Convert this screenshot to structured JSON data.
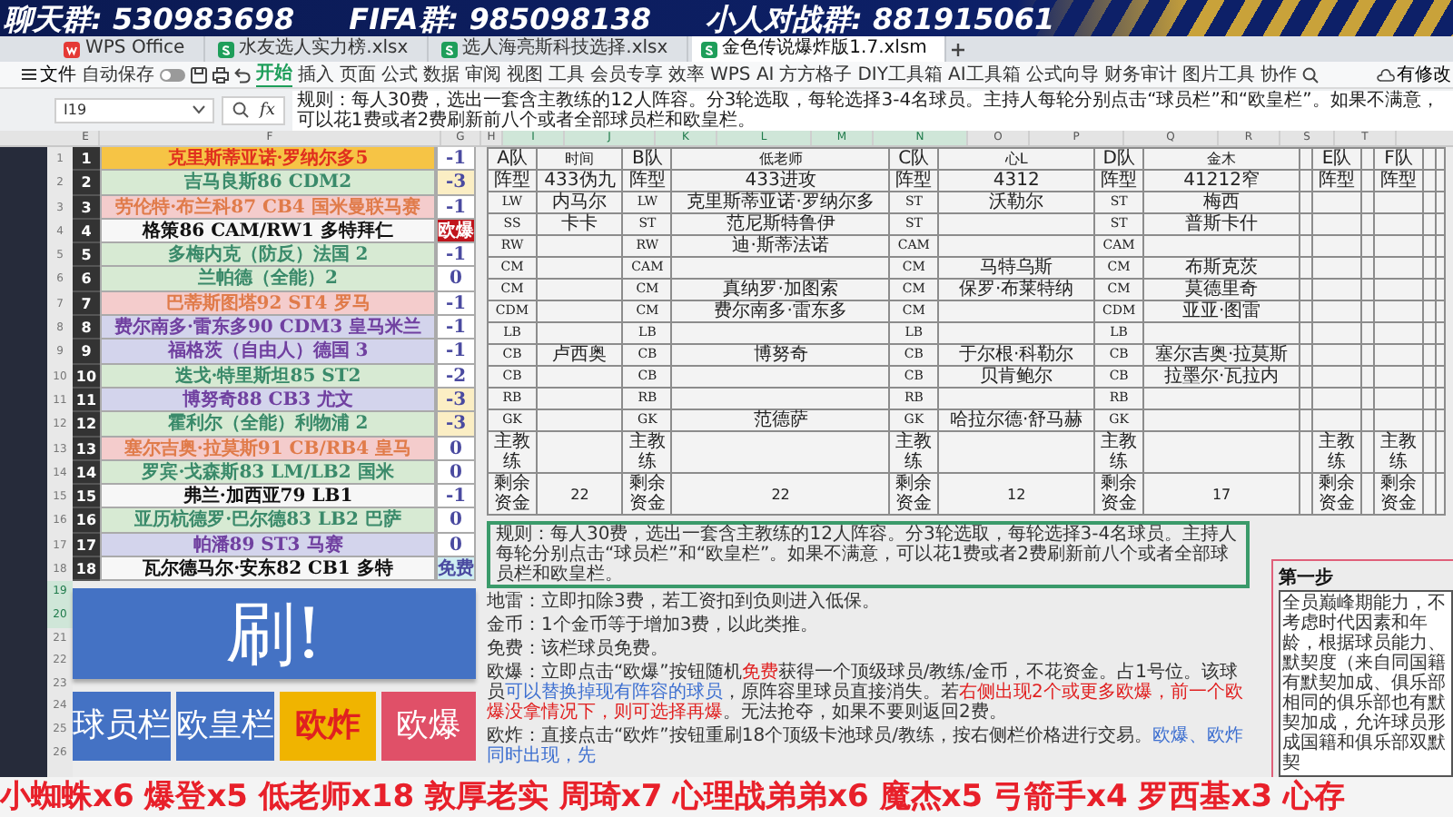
{
  "stream_banner": [
    "聊天群: 530983698",
    "FIFA群: 985098138",
    "小人对战群: 881915061"
  ],
  "tabs": [
    {
      "label": "WPS Office",
      "kind": "home",
      "selected": false
    },
    {
      "label": "水友选人实力榜.xlsx",
      "kind": "sheet",
      "selected": false
    },
    {
      "label": "选人海亮斯科技选择.xlsx",
      "kind": "sheet",
      "selected": false
    },
    {
      "label": "金色传说爆炸版1.7.xlsm",
      "kind": "sheet",
      "selected": true
    }
  ],
  "toolbar": {
    "file": "文件",
    "autosave": "自动保存",
    "autosave_on": false,
    "menu": [
      {
        "label": "开始",
        "selected": true
      },
      {
        "label": "插入",
        "selected": false
      },
      {
        "label": "页面",
        "selected": false
      },
      {
        "label": "公式",
        "selected": false
      },
      {
        "label": "数据",
        "selected": false
      },
      {
        "label": "审阅",
        "selected": false
      },
      {
        "label": "视图",
        "selected": false
      },
      {
        "label": "工具",
        "selected": false
      },
      {
        "label": "会员专享",
        "selected": false
      },
      {
        "label": "效率",
        "selected": false
      },
      {
        "label": "WPS AI",
        "selected": false
      },
      {
        "label": "方方格子",
        "selected": false
      },
      {
        "label": "DIY工具箱",
        "selected": false
      },
      {
        "label": "AI工具箱",
        "selected": false
      },
      {
        "label": "公式向导",
        "selected": false
      },
      {
        "label": "财务审计",
        "selected": false
      },
      {
        "label": "图片工具",
        "selected": false
      },
      {
        "label": "协作",
        "selected": false
      }
    ],
    "status": "有修改"
  },
  "formula_bar": {
    "cell": "I19",
    "fx": "fx",
    "content": "规则：每人30费，选出一套含主教练的12人阵容。分3轮选取，每轮选择3-4名球员。主持人每轮分别点击“球员栏”和“欧皇栏”。如果不满意，可以花1费或者2费刷新前八个或者全部球员栏和欧皇栏。"
  },
  "column_headers": [
    {
      "label": "E",
      "selected": false
    },
    {
      "label": "F",
      "selected": false
    },
    {
      "label": "G",
      "selected": false
    },
    {
      "label": "H",
      "selected": false
    },
    {
      "label": "I",
      "selected": true
    },
    {
      "label": "J",
      "selected": true
    },
    {
      "label": "K",
      "selected": true
    },
    {
      "label": "L",
      "selected": true
    },
    {
      "label": "M",
      "selected": true
    },
    {
      "label": "N",
      "selected": true
    },
    {
      "label": "O",
      "selected": false
    },
    {
      "label": "P",
      "selected": false
    },
    {
      "label": "Q",
      "selected": false
    },
    {
      "label": "R",
      "selected": false
    },
    {
      "label": "S",
      "selected": false
    },
    {
      "label": "T",
      "selected": false
    }
  ],
  "row_numbers": [
    {
      "label": "1",
      "selected": false
    },
    {
      "label": "2",
      "selected": false
    },
    {
      "label": "3",
      "selected": false
    },
    {
      "label": "4",
      "selected": false
    },
    {
      "label": "5",
      "selected": false
    },
    {
      "label": "6",
      "selected": false
    },
    {
      "label": "7",
      "selected": false
    },
    {
      "label": "8",
      "selected": false
    },
    {
      "label": "9",
      "selected": false
    },
    {
      "label": "10",
      "selected": false
    },
    {
      "label": "11",
      "selected": false
    },
    {
      "label": "12",
      "selected": false
    },
    {
      "label": "13",
      "selected": false
    },
    {
      "label": "14",
      "selected": false
    },
    {
      "label": "15",
      "selected": false
    },
    {
      "label": "16",
      "selected": false
    },
    {
      "label": "17",
      "selected": false
    },
    {
      "label": "18",
      "selected": false
    },
    {
      "label": "19",
      "selected": true
    },
    {
      "label": "20",
      "selected": true
    },
    {
      "label": "21",
      "selected": false
    },
    {
      "label": "22",
      "selected": false
    },
    {
      "label": "23",
      "selected": false
    },
    {
      "label": "24",
      "selected": false
    },
    {
      "label": "25",
      "selected": false
    },
    {
      "label": "26",
      "selected": false
    }
  ],
  "players": [
    {
      "number": "1",
      "name": "克里斯蒂亚诺·罗纳尔多5",
      "kind": "gold",
      "cost": {
        "text": "-1",
        "kind": "plain"
      }
    },
    {
      "number": "2",
      "name": "吉马良斯86 CDM2",
      "kind": "green",
      "cost": {
        "text": "-3",
        "kind": "warn"
      }
    },
    {
      "number": "3",
      "name": "劳伦特·布兰科87 CB4 国米曼联马赛",
      "kind": "pink",
      "cost": {
        "text": "-1",
        "kind": "plain"
      }
    },
    {
      "number": "4",
      "name": "格策86 CAM/RW1 多特拜仁",
      "kind": "white",
      "cost": {
        "text": "欧爆",
        "kind": "boom"
      }
    },
    {
      "number": "5",
      "name": "多梅内克（防反）法国 2",
      "kind": "green",
      "cost": {
        "text": "-1",
        "kind": "plain"
      }
    },
    {
      "number": "6",
      "name": "兰帕德（全能）2",
      "kind": "green",
      "cost": {
        "text": "0",
        "kind": "plain"
      }
    },
    {
      "number": "7",
      "name": "巴蒂斯图塔92 ST4 罗马",
      "kind": "pink",
      "cost": {
        "text": "-1",
        "kind": "plain"
      }
    },
    {
      "number": "8",
      "name": "费尔南多·雷东多90 CDM3 皇马米兰",
      "kind": "purple",
      "cost": {
        "text": "-1",
        "kind": "plain"
      }
    },
    {
      "number": "9",
      "name": "福格茨（自由人）德国 3",
      "kind": "purple",
      "cost": {
        "text": "-1",
        "kind": "plain"
      }
    },
    {
      "number": "10",
      "name": "迭戈·特里斯坦85 ST2",
      "kind": "green",
      "cost": {
        "text": "-2",
        "kind": "plain"
      }
    },
    {
      "number": "11",
      "name": "博努奇88 CB3 尤文",
      "kind": "purple",
      "cost": {
        "text": "-3",
        "kind": "warn"
      }
    },
    {
      "number": "12",
      "name": "霍利尔（全能）利物浦 2",
      "kind": "green",
      "cost": {
        "text": "-3",
        "kind": "warn"
      }
    },
    {
      "number": "13",
      "name": "塞尔吉奥·拉莫斯91 CB/RB4 皇马",
      "kind": "pink",
      "cost": {
        "text": "0",
        "kind": "plain"
      }
    },
    {
      "number": "14",
      "name": "罗宾·戈森斯83 LM/LB2 国米",
      "kind": "green",
      "cost": {
        "text": "0",
        "kind": "plain"
      }
    },
    {
      "number": "15",
      "name": "弗兰·加西亚79 LB1",
      "kind": "white",
      "cost": {
        "text": "-1",
        "kind": "plain"
      }
    },
    {
      "number": "16",
      "name": "亚历杭德罗·巴尔德83 LB2 巴萨",
      "kind": "green",
      "cost": {
        "text": "0",
        "kind": "plain"
      }
    },
    {
      "number": "17",
      "name": "帕潘89 ST3 马赛",
      "kind": "purple",
      "cost": {
        "text": "0",
        "kind": "plain"
      }
    },
    {
      "number": "18",
      "name": "瓦尔德马尔·安东82 CB1 多特",
      "kind": "white",
      "cost": {
        "text": "免费",
        "kind": "free"
      }
    }
  ],
  "refresh_button": "刷!",
  "action_buttons": [
    {
      "label": "球员栏",
      "kind": "blue"
    },
    {
      "label": "欧皇栏",
      "kind": "blue"
    },
    {
      "label": "欧炸",
      "kind": "gold"
    },
    {
      "label": "欧爆",
      "kind": "red"
    }
  ],
  "teams": [
    {
      "header": "A队",
      "owner": "时间",
      "formation_label": "阵型",
      "formation": "433伪九",
      "slots": [
        {
          "pos": "LW",
          "player": "内马尔"
        },
        {
          "pos": "SS",
          "player": "卡卡"
        },
        {
          "pos": "RW"
        },
        {
          "pos": "CM"
        },
        {
          "pos": "CM"
        },
        {
          "pos": "CDM"
        },
        {
          "pos": "LB"
        },
        {
          "pos": "CB",
          "player": "卢西奥"
        },
        {
          "pos": "CB"
        },
        {
          "pos": "RB"
        },
        {
          "pos": "GK"
        }
      ],
      "coach_label": "主教练",
      "funds_label": "剩余资金",
      "funds": "22"
    },
    {
      "header": "B队",
      "owner": "低老师",
      "formation_label": "阵型",
      "formation": "433进攻",
      "slots": [
        {
          "pos": "LW",
          "player": "克里斯蒂亚诺·罗纳尔多"
        },
        {
          "pos": "ST",
          "player": "范尼斯特鲁伊"
        },
        {
          "pos": "RW",
          "player": "迪·斯蒂法诺"
        },
        {
          "pos": "CAM"
        },
        {
          "pos": "CM",
          "player": "真纳罗·加图索"
        },
        {
          "pos": "CM",
          "player": "费尔南多·雷东多"
        },
        {
          "pos": "LB"
        },
        {
          "pos": "CB",
          "player": "博努奇"
        },
        {
          "pos": "CB"
        },
        {
          "pos": "RB"
        },
        {
          "pos": "GK",
          "player": "范德萨"
        }
      ],
      "coach_label": "主教练",
      "funds_label": "剩余资金",
      "funds": "22"
    },
    {
      "header": "C队",
      "owner": "心L",
      "formation_label": "阵型",
      "formation": "4312",
      "slots": [
        {
          "pos": "ST",
          "player": "沃勒尔"
        },
        {
          "pos": "ST"
        },
        {
          "pos": "CAM"
        },
        {
          "pos": "CM",
          "player": "马特乌斯"
        },
        {
          "pos": "CM",
          "player": "保罗·布莱特纳"
        },
        {
          "pos": "CM"
        },
        {
          "pos": "LB"
        },
        {
          "pos": "CB",
          "player": "于尔根·科勒尔"
        },
        {
          "pos": "CB",
          "player": "贝肯鲍尔"
        },
        {
          "pos": "RB"
        },
        {
          "pos": "GK",
          "player": "哈拉尔德·舒马赫"
        }
      ],
      "coach_label": "主教练",
      "funds_label": "剩余资金",
      "funds": "12"
    },
    {
      "header": "D队",
      "owner": "金木",
      "formation_label": "阵型",
      "formation": "41212窄",
      "slots": [
        {
          "pos": "ST",
          "player": "梅西"
        },
        {
          "pos": "ST",
          "player": "普斯卡什"
        },
        {
          "pos": "CAM"
        },
        {
          "pos": "CM",
          "player": "布斯克茨"
        },
        {
          "pos": "CM",
          "player": "莫德里奇"
        },
        {
          "pos": "CDM",
          "player": "亚亚·图雷"
        },
        {
          "pos": "LB"
        },
        {
          "pos": "CB",
          "player": "塞尔吉奥·拉莫斯"
        },
        {
          "pos": "CB",
          "player": "拉墨尔·瓦拉内"
        },
        {
          "pos": "RB"
        },
        {
          "pos": "GK"
        }
      ],
      "coach_label": "主教练",
      "funds_label": "剩余资金",
      "funds": "17"
    },
    {
      "header": "E队",
      "formation_label": "阵型",
      "coach_label": "主教练",
      "funds_label": "剩余资金"
    },
    {
      "header": "F队",
      "formation_label": "阵型",
      "coach_label": "主教练",
      "funds_label": "剩余资金"
    }
  ],
  "rules": {
    "summary": "规则：每人30费，选出一套含主教练的12人阵容。分3轮选取，每轮选择3-4名球员。主持人每轮分别点击“球员栏”和“欧皇栏”。如果不满意，可以花1费或者2费刷新前八个或者全部球员栏和欧皇栏。",
    "entries": [
      {
        "segments": [
          {
            "text": "地雷：立即扣除3费，若工资扣到负则进入低保。",
            "kind": "plain"
          }
        ]
      },
      {
        "segments": [
          {
            "text": "金币：1个金币等于增加3费，以此类推。",
            "kind": "plain"
          }
        ]
      },
      {
        "segments": [
          {
            "text": "免费：该栏球员免费。",
            "kind": "plain"
          }
        ]
      },
      {
        "segments": [
          {
            "text": "欧爆：立即点击“欧爆”按钮随机",
            "kind": "plain"
          },
          {
            "text": "免费",
            "kind": "red"
          },
          {
            "text": "获得一个顶级球员/教练/金币，不花资金。占1号位。该球员",
            "kind": "plain"
          },
          {
            "text": "可以替换掉现有阵容的球员",
            "kind": "blue"
          },
          {
            "text": "，原阵容里球员直接消失。若",
            "kind": "plain"
          },
          {
            "text": "右侧出现2个或更多欧爆，前一个欧爆没拿情况下，则可选择再爆",
            "kind": "red"
          },
          {
            "text": "。无法抢夺，如果不要则返回2费。",
            "kind": "plain"
          }
        ]
      },
      {
        "segments": [
          {
            "text": "欧炸：直接点击“欧炸”按钮重刷18个顶级卡池球员/教练，按右侧栏价格进行交易。",
            "kind": "plain"
          },
          {
            "text": "欧爆、欧炸同时出现，先",
            "kind": "blue"
          }
        ]
      }
    ]
  },
  "step_box": {
    "title": "第一步",
    "text": "全员巅峰期能力，不考虑时代因素和年龄，根据球员能力、默契度（来自同国籍有默契加成、俱乐部相同的俱乐部也有默契加成，允许球员形成国籍和俱乐部双默契"
  },
  "gift_ticker": "小蜘蛛x6 爆登x5 低老师x18 敦厚老实 周琦x7 心理战弟弟x6 魔杰x5 弓箭手x4 罗西基x3 心存"
}
